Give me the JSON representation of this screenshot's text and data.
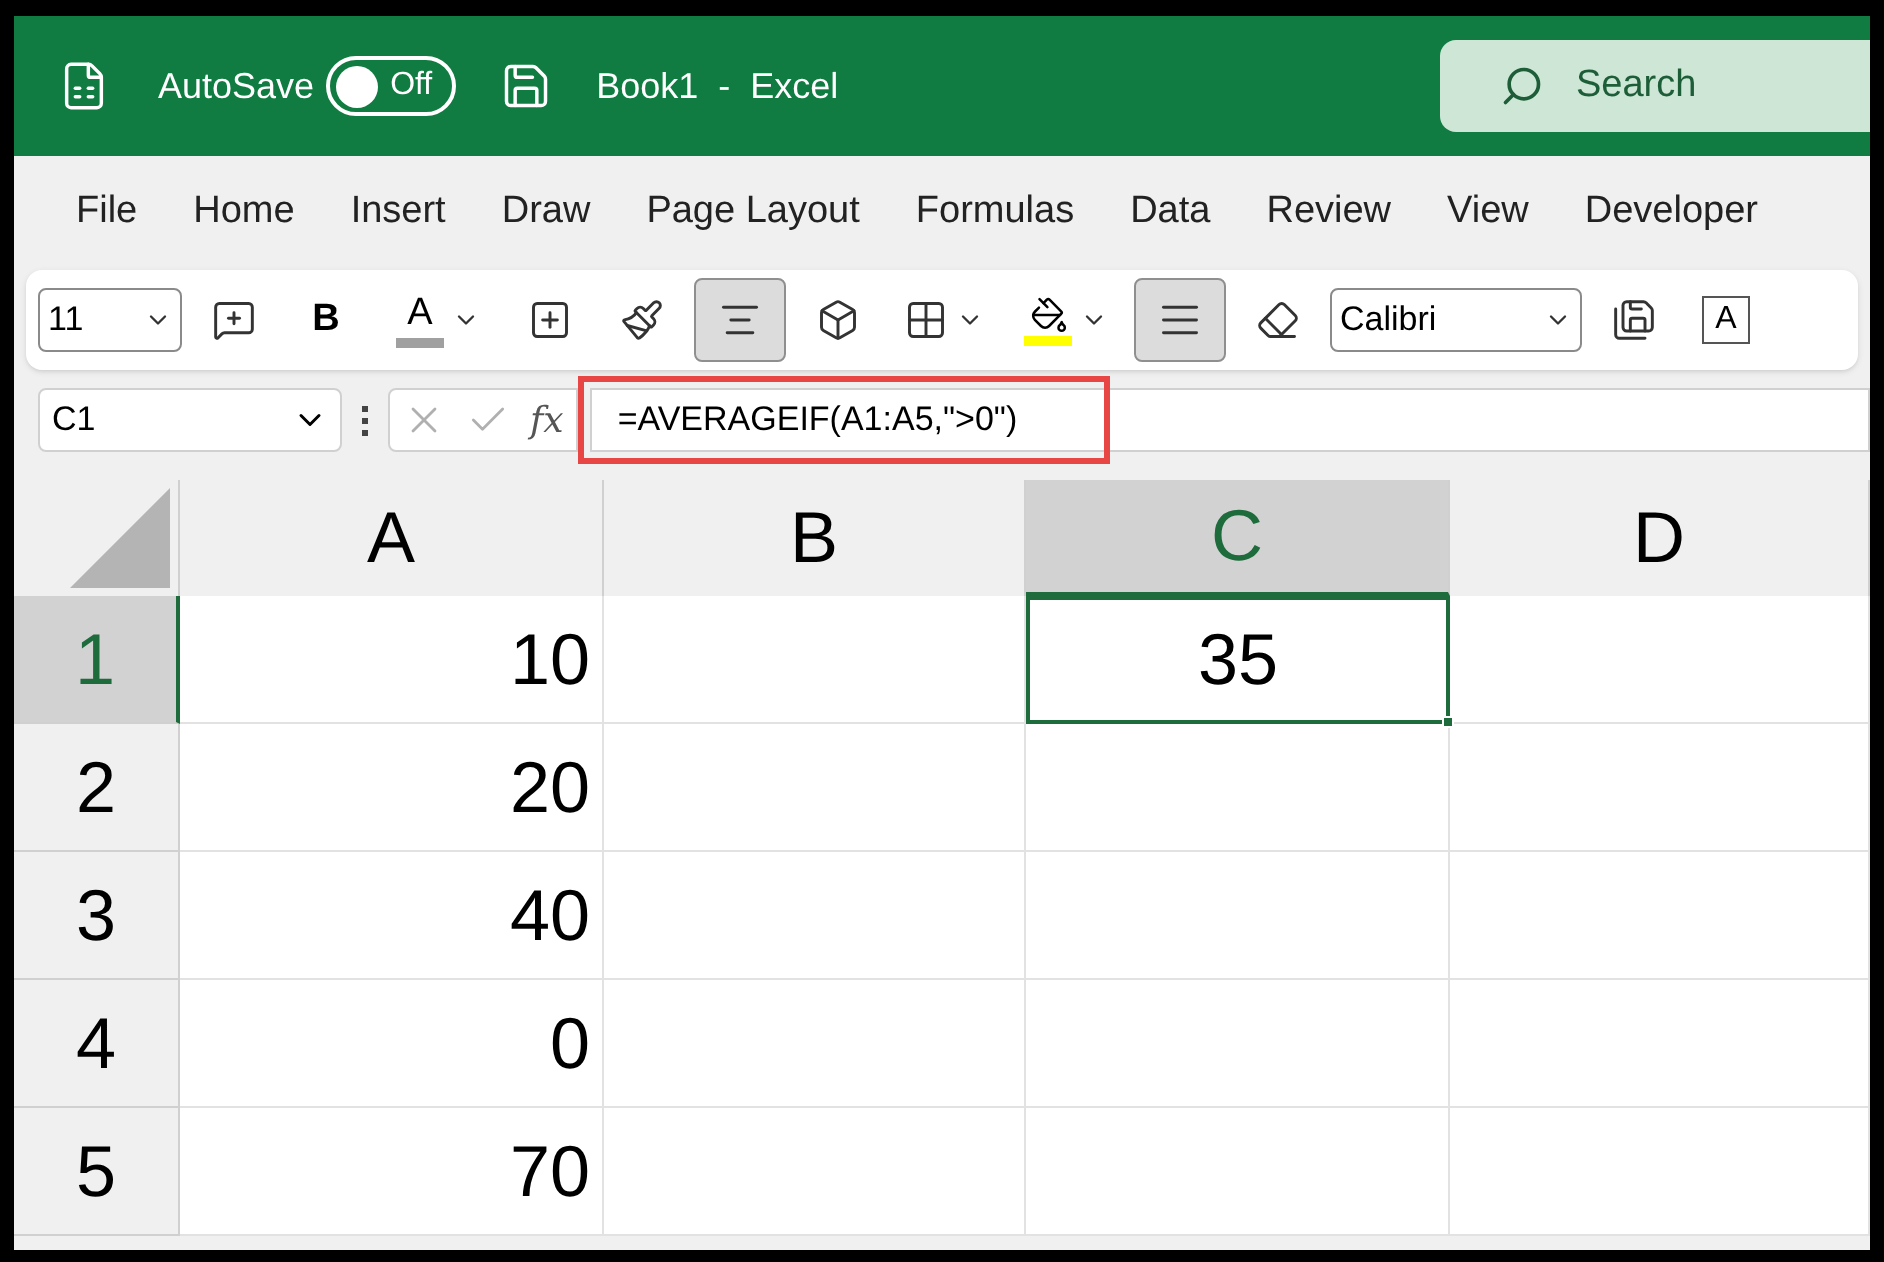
{
  "title_bar": {
    "autosave_label": "AutoSave",
    "autosave_toggle": {
      "label": "Off",
      "on": false
    },
    "document_title": "Book1  -  Excel",
    "search": {
      "placeholder": "Search"
    }
  },
  "menu_tabs": [
    {
      "label": "File",
      "selected": false
    },
    {
      "label": "Home",
      "selected": false
    },
    {
      "label": "Insert",
      "selected": false
    },
    {
      "label": "Draw",
      "selected": false
    },
    {
      "label": "Page Layout",
      "selected": false
    },
    {
      "label": "Formulas",
      "selected": false
    },
    {
      "label": "Data",
      "selected": false
    },
    {
      "label": "Review",
      "selected": false
    },
    {
      "label": "View",
      "selected": false
    },
    {
      "label": "Developer",
      "selected": false
    }
  ],
  "toolbar": [
    {
      "kind": "fontsize",
      "value": "11"
    },
    {
      "kind": "comment"
    },
    {
      "kind": "bold",
      "label": "B",
      "selected": false
    },
    {
      "kind": "fontcolor",
      "label": "A",
      "color": "#a0a0a0"
    },
    {
      "kind": "insert"
    },
    {
      "kind": "brush"
    },
    {
      "kind": "center",
      "selected": true
    },
    {
      "kind": "cube"
    },
    {
      "kind": "border"
    },
    {
      "kind": "fillcolor",
      "color": "#ffff00"
    },
    {
      "kind": "justify",
      "selected": true
    },
    {
      "kind": "clear"
    },
    {
      "kind": "fontname",
      "value": "Calibri"
    },
    {
      "kind": "save"
    },
    {
      "kind": "textbox",
      "label": "A"
    }
  ],
  "formula_bar": {
    "name_box": "C1",
    "fx": "fx",
    "formula": "=AVERAGEIF(A1:A5,\">0\")",
    "highlighted": true
  },
  "sheet": {
    "columns": [
      {
        "label": "A",
        "selected": false
      },
      {
        "label": "B",
        "selected": false
      },
      {
        "label": "C",
        "selected": true
      },
      {
        "label": "D",
        "selected": false
      }
    ],
    "rows": [
      {
        "label": "1",
        "selected": true,
        "cells": [
          {
            "value": "10",
            "selected": false
          },
          {
            "selected": false
          },
          {
            "value": "35",
            "selected": true
          },
          {
            "selected": false
          }
        ]
      },
      {
        "label": "2",
        "selected": false,
        "cells": [
          {
            "value": "20",
            "selected": false
          },
          {
            "selected": false
          },
          {
            "selected": false
          },
          {
            "selected": false
          }
        ]
      },
      {
        "label": "3",
        "selected": false,
        "cells": [
          {
            "value": "40",
            "selected": false
          },
          {
            "selected": false
          },
          {
            "selected": false
          },
          {
            "selected": false
          }
        ]
      },
      {
        "label": "4",
        "selected": false,
        "cells": [
          {
            "value": "0",
            "selected": false
          },
          {
            "selected": false
          },
          {
            "selected": false
          },
          {
            "selected": false
          }
        ]
      },
      {
        "label": "5",
        "selected": false,
        "cells": [
          {
            "value": "70",
            "selected": false
          },
          {
            "selected": false
          },
          {
            "selected": false
          },
          {
            "selected": false
          }
        ]
      }
    ]
  }
}
